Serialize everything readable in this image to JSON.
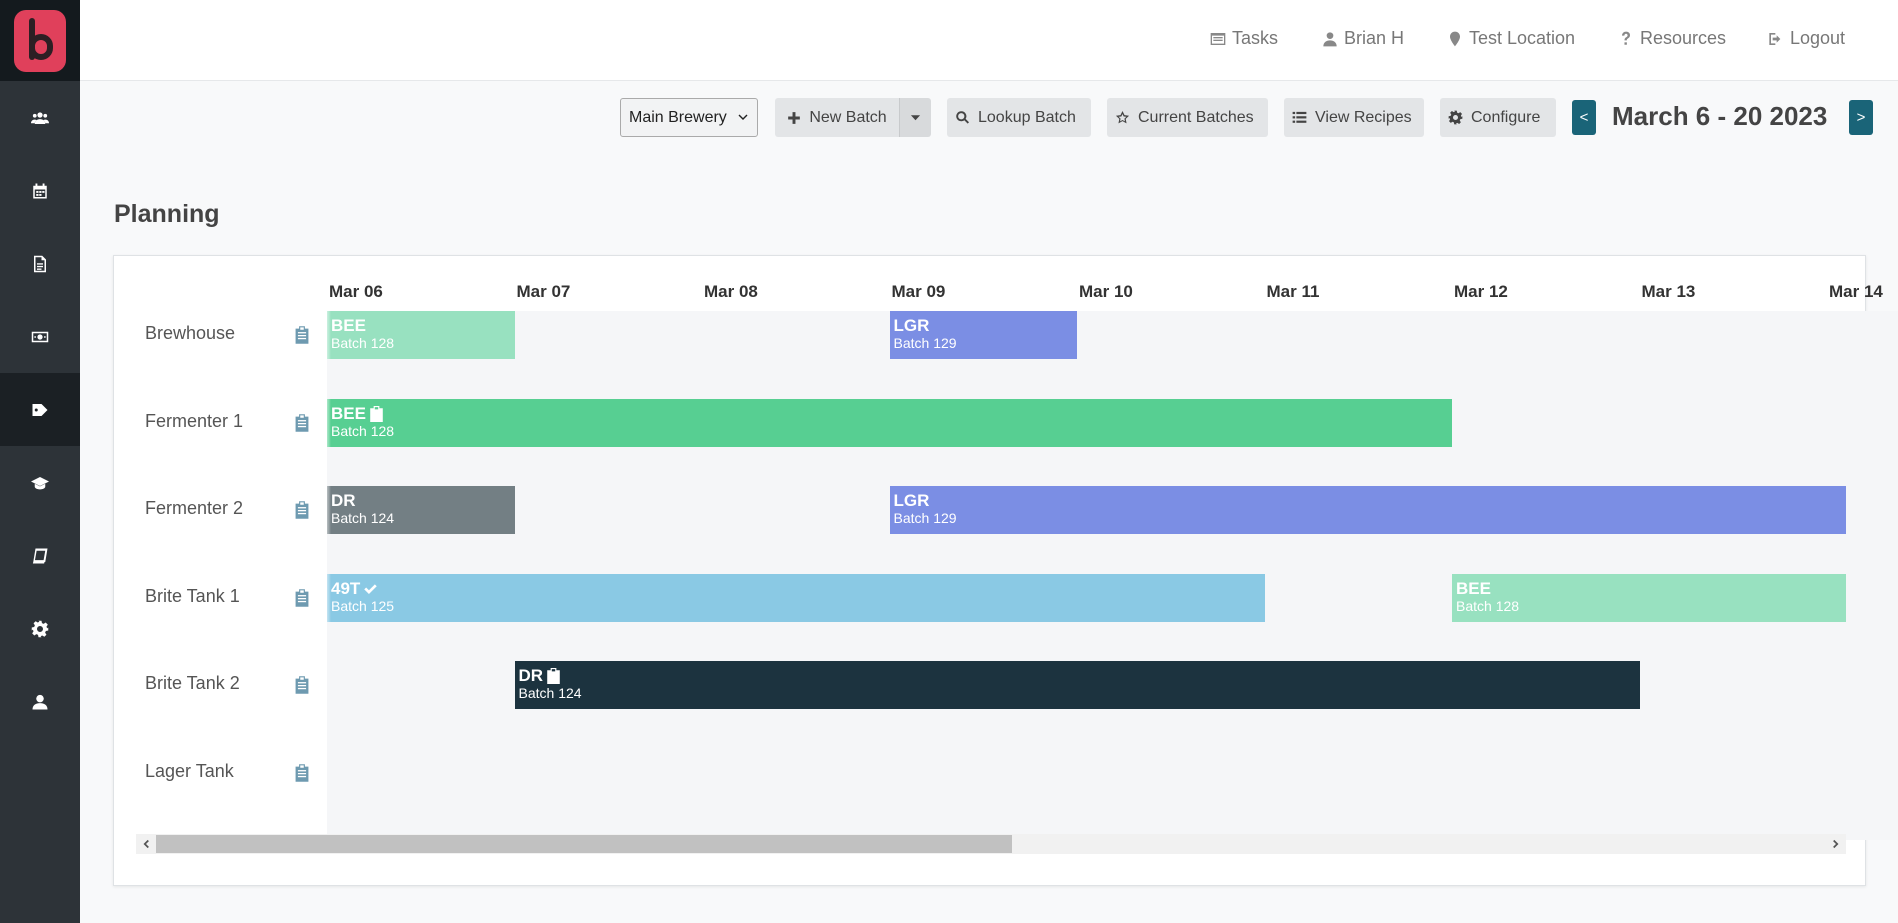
{
  "sidebar": {
    "logo": "brewery-logo",
    "items": [
      {
        "icon": "users-icon"
      },
      {
        "icon": "calendar-icon"
      },
      {
        "icon": "document-icon"
      },
      {
        "icon": "money-icon"
      },
      {
        "icon": "tag-icon",
        "active": true
      },
      {
        "icon": "graduation-cap-icon"
      },
      {
        "icon": "book-icon"
      },
      {
        "icon": "gear-icon"
      },
      {
        "icon": "user-icon"
      }
    ]
  },
  "topnav": {
    "tasks": "Tasks",
    "user": "Brian H",
    "location": "Test Location",
    "resources": "Resources",
    "logout": "Logout"
  },
  "toolbar": {
    "brewery_select": "Main Brewery",
    "new_batch": "New Batch",
    "lookup_batch": "Lookup Batch",
    "current_batches": "Current Batches",
    "view_recipes": "View Recipes",
    "configure": "Configure",
    "prev": "<",
    "next": ">",
    "date_range": "March 6 - 20 2023"
  },
  "page": {
    "title": "Planning"
  },
  "timeline": {
    "ticks": [
      "Mar 06",
      "Mar 07",
      "Mar 08",
      "Mar 09",
      "Mar 10",
      "Mar 11",
      "Mar 12",
      "Mar 13",
      "Mar 14"
    ],
    "rows": [
      {
        "label": "Brewhouse"
      },
      {
        "label": "Fermenter 1"
      },
      {
        "label": "Fermenter 2"
      },
      {
        "label": "Brite Tank 1"
      },
      {
        "label": "Brite Tank 2"
      },
      {
        "label": "Lager Tank"
      }
    ],
    "batches": [
      {
        "row": 0,
        "start": 0,
        "end": 1,
        "name": "BEE",
        "sub": "Batch 128",
        "color": "#98e1c0",
        "icon": "",
        "fade": true
      },
      {
        "row": 0,
        "start": 3,
        "end": 4,
        "name": "LGR",
        "sub": "Batch 129",
        "color": "#7b8ee4",
        "icon": "",
        "fade": false
      },
      {
        "row": 1,
        "start": 0,
        "end": 6,
        "name": "BEE",
        "sub": "Batch 128",
        "color": "#57cf92",
        "icon": "clipboard-icon",
        "fade": true
      },
      {
        "row": 2,
        "start": 0,
        "end": 1,
        "name": "DR",
        "sub": "Batch 124",
        "color": "#737f84",
        "icon": "",
        "fade": true
      },
      {
        "row": 2,
        "start": 3,
        "end": 8.1,
        "name": "LGR",
        "sub": "Batch 129",
        "color": "#7b8ee4",
        "icon": "",
        "fade": false
      },
      {
        "row": 3,
        "start": 0,
        "end": 5,
        "name": "49T",
        "sub": "Batch 125",
        "color": "#8ac9e4",
        "icon": "check-icon",
        "fade": true
      },
      {
        "row": 3,
        "start": 6,
        "end": 8.1,
        "name": "BEE",
        "sub": "Batch 128",
        "color": "#98e1c0",
        "icon": "",
        "fade": false
      },
      {
        "row": 4,
        "start": 1,
        "end": 7,
        "name": "DR",
        "sub": "Batch 124",
        "color": "#1c333f",
        "icon": "clipboard-icon",
        "fade": false
      }
    ]
  },
  "scrollbar": {
    "position": 0.0,
    "visible_fraction": 0.5
  }
}
